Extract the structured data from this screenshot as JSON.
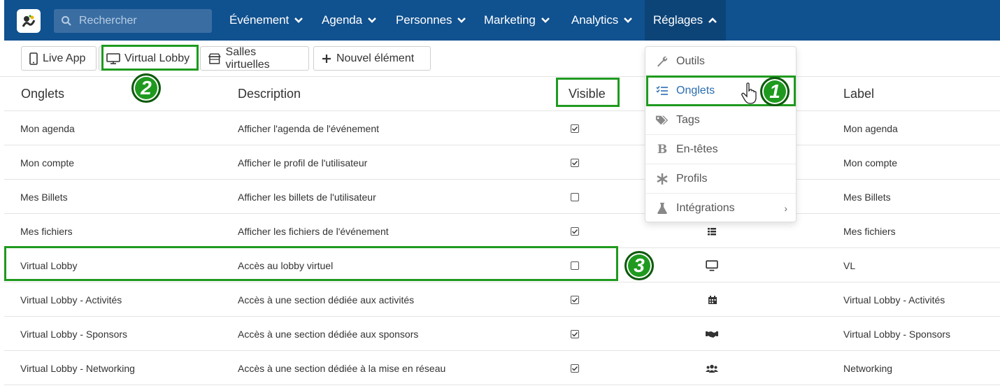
{
  "nav": {
    "search_placeholder": "Rechercher",
    "items": [
      {
        "label": "Événement",
        "open": false
      },
      {
        "label": "Agenda",
        "open": false
      },
      {
        "label": "Personnes",
        "open": false
      },
      {
        "label": "Marketing",
        "open": false
      },
      {
        "label": "Analytics",
        "open": false
      },
      {
        "label": "Réglages",
        "open": true
      }
    ]
  },
  "toolbar": {
    "buttons": [
      {
        "label": "Live App",
        "icon": "mobile-icon"
      },
      {
        "label": "Virtual Lobby",
        "icon": "desktop-icon"
      },
      {
        "label": "Salles virtuelles",
        "icon": "store-icon"
      },
      {
        "label": "Nouvel élément",
        "icon": "plus-icon"
      }
    ]
  },
  "table": {
    "headers": {
      "tabs": "Onglets",
      "description": "Description",
      "visible": "Visible",
      "label": "Label"
    },
    "rows": [
      {
        "tab": "Mon agenda",
        "description": "Afficher l'agenda de l'événement",
        "visible": true,
        "icon": "",
        "label": "Mon agenda"
      },
      {
        "tab": "Mon compte",
        "description": "Afficher le profil de l'utilisateur",
        "visible": true,
        "icon": "",
        "label": "Mon compte"
      },
      {
        "tab": "Mes Billets",
        "description": "Afficher les billets de l'utilisateur",
        "visible": false,
        "icon": "",
        "label": "Mes Billets"
      },
      {
        "tab": "Mes fichiers",
        "description": "Afficher les fichiers de l'événement",
        "visible": true,
        "icon": "list-icon",
        "label": "Mes fichiers"
      },
      {
        "tab": "Virtual Lobby",
        "description": "Accès au lobby virtuel",
        "visible": false,
        "icon": "desktop-icon",
        "label": "VL"
      },
      {
        "tab": "Virtual Lobby - Activités",
        "description": "Accès à une section dédiée aux activités",
        "visible": true,
        "icon": "calendar-icon",
        "label": "Virtual Lobby - Activités"
      },
      {
        "tab": "Virtual Lobby - Sponsors",
        "description": "Accès à une section dédiée aux sponsors",
        "visible": true,
        "icon": "handshake-icon",
        "label": "Virtual Lobby - Sponsors"
      },
      {
        "tab": "Virtual Lobby - Networking",
        "description": "Accès à une section dédiée à la mise en réseau",
        "visible": true,
        "icon": "users-icon",
        "label": "Networking"
      }
    ]
  },
  "dropdown": {
    "items": [
      {
        "label": "Outils",
        "icon": "wrench-icon"
      },
      {
        "label": "Onglets",
        "icon": "tasks-icon",
        "selected": true
      },
      {
        "label": "Tags",
        "icon": "tags-icon"
      },
      {
        "label": "En-têtes",
        "icon": "bold-icon"
      },
      {
        "label": "Profils",
        "icon": "asterisk-icon"
      },
      {
        "label": "Intégrations",
        "icon": "flask-icon",
        "has_submenu": true
      }
    ]
  },
  "annotations": [
    "1",
    "2",
    "3"
  ],
  "colors": {
    "nav_bg": "#10518f",
    "nav_active": "#0d4478",
    "highlight": "#1f9a1f",
    "selected_text": "#2a6db0"
  }
}
